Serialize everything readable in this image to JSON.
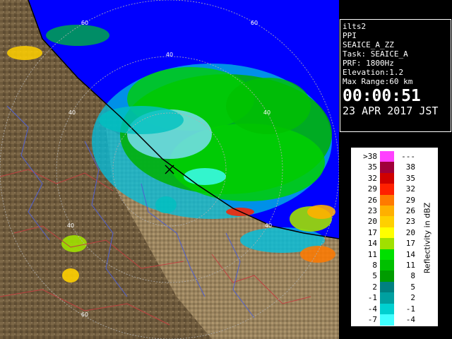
{
  "info": {
    "lines": [
      "ilts2",
      "PPI",
      "SEAICE_A_ZZ",
      "Task: SEAICE_A",
      "PRF: 1800Hz",
      "Elevation:1.2",
      "Max Range:60 km"
    ],
    "time": "00:00:51",
    "date": "23 APR 2017 JST"
  },
  "legend": {
    "title": "Reflectivity in dBZ",
    "rows": [
      {
        "lo": ">38",
        "hi": "---",
        "color": "#ff40ff"
      },
      {
        "lo": "35",
        "hi": "38",
        "color": "#a0003a"
      },
      {
        "lo": "32",
        "hi": "35",
        "color": "#d00000"
      },
      {
        "lo": "29",
        "hi": "32",
        "color": "#ff2000"
      },
      {
        "lo": "26",
        "hi": "29",
        "color": "#ff7a00"
      },
      {
        "lo": "23",
        "hi": "26",
        "color": "#ffb000"
      },
      {
        "lo": "20",
        "hi": "23",
        "color": "#ffd000"
      },
      {
        "lo": "17",
        "hi": "20",
        "color": "#ffff00"
      },
      {
        "lo": "14",
        "hi": "17",
        "color": "#a0e000"
      },
      {
        "lo": "11",
        "hi": "14",
        "color": "#00e000"
      },
      {
        "lo": "8",
        "hi": "11",
        "color": "#00c000"
      },
      {
        "lo": "5",
        "hi": "8",
        "color": "#009c00"
      },
      {
        "lo": "2",
        "hi": "5",
        "color": "#008080"
      },
      {
        "lo": "-1",
        "hi": "2",
        "color": "#00a0a0"
      },
      {
        "lo": "-4",
        "hi": "-1",
        "color": "#00d0d0"
      },
      {
        "lo": "-7",
        "hi": "-4",
        "color": "#40ffff"
      }
    ]
  },
  "map": {
    "range_labels": [
      "60",
      "60",
      "40",
      "40",
      "40",
      "40",
      "40",
      "60"
    ],
    "colors": {
      "sea": "#0000ff",
      "land": "#6e5a3c",
      "ring": "#b0b0b0"
    }
  }
}
